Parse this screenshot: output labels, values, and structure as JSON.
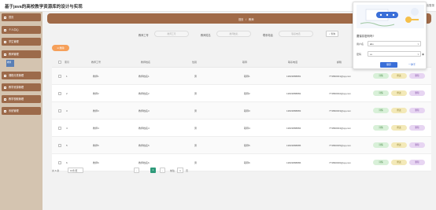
{
  "app": {
    "title": "基于java的高校教学资源库的设计与实现",
    "top_right": "退出登录"
  },
  "sidebar": {
    "items": [
      {
        "label": "首页"
      },
      {
        "label": "个人中心"
      },
      {
        "label": "学生管理"
      },
      {
        "label": "教师管理"
      },
      {
        "label": "课程分类管理"
      },
      {
        "label": "教学资源管理"
      },
      {
        "label": "教学视频管理"
      },
      {
        "label": "系统管理"
      }
    ],
    "sub_item": "教师"
  },
  "breadcrumb": {
    "home": "首页",
    "separator": "/",
    "current": "教师"
  },
  "search": {
    "fields": [
      {
        "label": "教师工号",
        "placeholder": "教师工号"
      },
      {
        "label": "教师姓名",
        "placeholder": "教师姓名"
      },
      {
        "label": "联系电话",
        "placeholder": "联系电话"
      }
    ],
    "button": "查询"
  },
  "toolbar": {
    "delete_label": "删除"
  },
  "table": {
    "columns": [
      "索引",
      "教师工号",
      "教师姓名",
      "性别",
      "职称",
      "联系电话",
      "邮箱",
      "操作"
    ],
    "rows": [
      {
        "index": "1",
        "id": "教师1",
        "name": "教师姓名1",
        "gender": "男",
        "title": "职称1",
        "phone": "13823888881",
        "email": "773890001@qq.com"
      },
      {
        "index": "2",
        "id": "教师2",
        "name": "教师姓名2",
        "gender": "男",
        "title": "职称2",
        "phone": "13823888882",
        "email": "773890002@qq.com"
      },
      {
        "index": "3",
        "id": "教师3",
        "name": "教师姓名3",
        "gender": "男",
        "title": "职称3",
        "phone": "13823888883",
        "email": "773890003@qq.com"
      },
      {
        "index": "4",
        "id": "教师4",
        "name": "教师姓名4",
        "gender": "男",
        "title": "职称4",
        "phone": "13823888884",
        "email": "773890004@qq.com"
      },
      {
        "index": "5",
        "id": "教师5",
        "name": "教师姓名5",
        "gender": "男",
        "title": "职称5",
        "phone": "13823888885",
        "email": "773890005@qq.com"
      },
      {
        "index": "6",
        "id": "教师6",
        "name": "教师姓名6",
        "gender": "男",
        "title": "职称6",
        "phone": "13823888886",
        "email": "773890006@qq.com"
      }
    ],
    "actions": {
      "detail": "详情",
      "edit": "修改",
      "delete": "删除"
    }
  },
  "pagination": {
    "total": "共 6 条",
    "page_size": "10条/页",
    "prev": "‹",
    "current_page": "1",
    "next": "›",
    "goto_label": "前往",
    "goto_value": "1",
    "page_suffix": "页"
  },
  "overlay": {
    "title": "要保存密码吗?",
    "username_label": "用户名",
    "username_value": "abo",
    "password_label": "密码",
    "password_value": "•••",
    "save_button": "保存",
    "never_link": "一律不"
  }
}
